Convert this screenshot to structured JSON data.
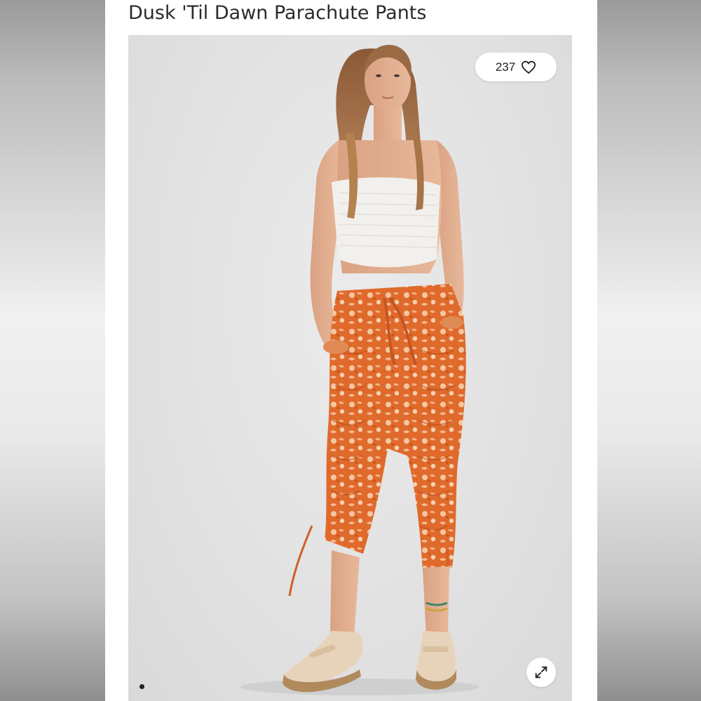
{
  "product": {
    "title": "Dusk 'Til Dawn Parachute Pants"
  },
  "image": {
    "description_icon": "model-photo",
    "likes": {
      "count": "237",
      "icon": "heart-outline-icon"
    },
    "expand_icon": "expand-arrows-icon",
    "carousel": {
      "active_index": 1
    }
  },
  "colors": {
    "pants_primary": "#e0692a",
    "pants_secondary": "#f3c8a4",
    "top": "#f2f0ec",
    "shoes": "#e7d3b9"
  }
}
